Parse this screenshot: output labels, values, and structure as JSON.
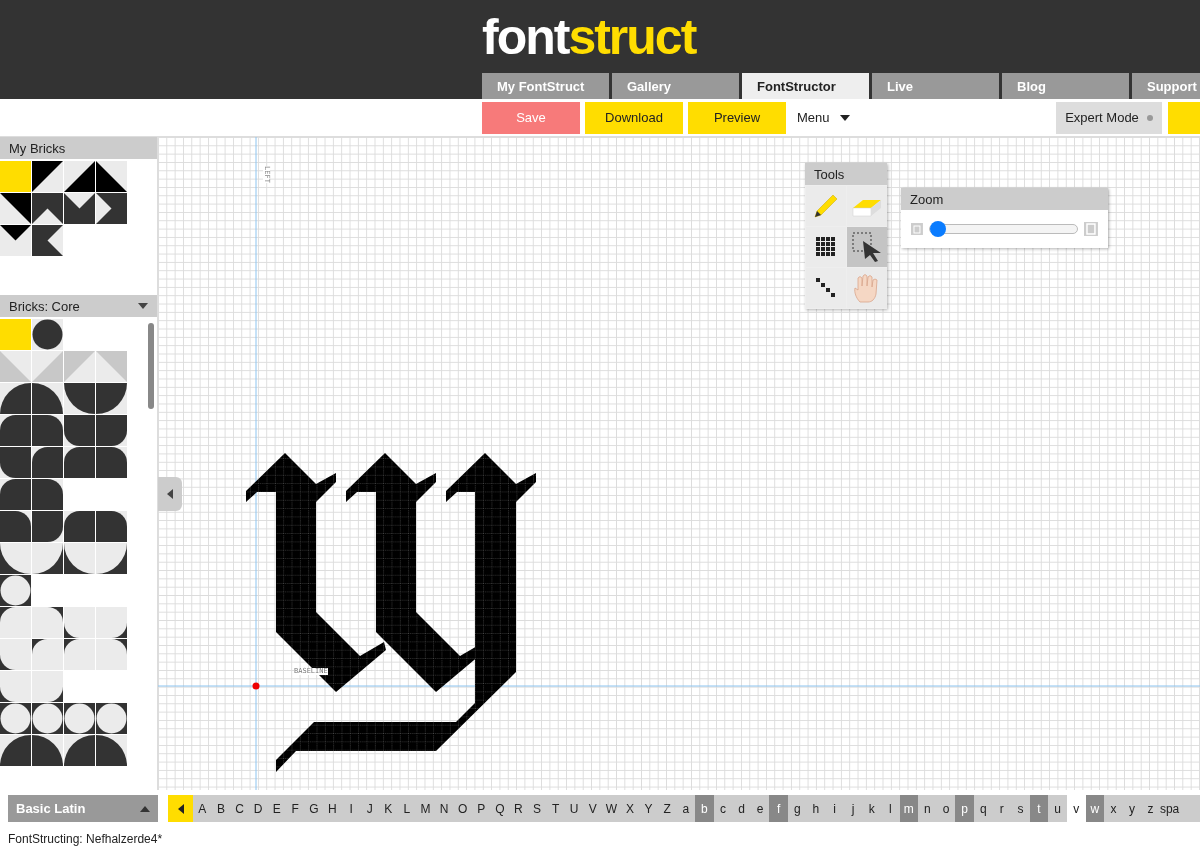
{
  "logo": {
    "part1": "font",
    "part2": "struct"
  },
  "tabs": [
    {
      "label": "My FontStruct",
      "selected": false
    },
    {
      "label": "Gallery",
      "selected": false
    },
    {
      "label": "FontStructor",
      "selected": true
    },
    {
      "label": "Live",
      "selected": false
    },
    {
      "label": "Blog",
      "selected": false
    },
    {
      "label": "Support",
      "selected": false
    }
  ],
  "toolbar": {
    "buttons": [
      {
        "label": "Save",
        "kind": "save"
      },
      {
        "label": "Download",
        "kind": "action"
      },
      {
        "label": "Preview",
        "kind": "action"
      }
    ],
    "menu": "Menu",
    "expert_mode": {
      "label": "Expert Mode",
      "on": false
    }
  },
  "my_bricks": {
    "title": "My Bricks",
    "rows": [
      [
        {
          "kind": "solid_tl_black",
          "selected": true
        },
        {
          "kind": "tri_tl_black",
          "selected": false
        },
        {
          "kind": "tri_br_black",
          "selected": false
        },
        {
          "kind": "tri_bl_black",
          "selected": false
        }
      ],
      [
        {
          "kind": "tri_tr_black",
          "selected": false
        },
        {
          "kind": "tri_b_inverse",
          "selected": false
        },
        {
          "kind": "tri_t_inverse",
          "selected": false
        },
        {
          "kind": "tri_l_inverse",
          "selected": false
        }
      ],
      [
        {
          "kind": "tri_t_black",
          "selected": false
        },
        {
          "kind": "tri_r_inverse",
          "selected": false
        }
      ]
    ]
  },
  "core_bricks": {
    "title": "Bricks: Core",
    "rows": [
      [
        {
          "kind": "solid_tl_dark",
          "selected": true
        },
        {
          "kind": "circle_tl_dark",
          "selected": false
        }
      ],
      [
        {
          "kind": "tri_bl_grey",
          "selected": false
        },
        {
          "kind": "tri_br_grey",
          "selected": false
        },
        {
          "kind": "tri_tl_grey",
          "selected": false
        },
        {
          "kind": "tri_tr_grey",
          "selected": false
        }
      ],
      [
        {
          "kind": "quarter_br_dark",
          "selected": false
        },
        {
          "kind": "quarter_bl_dark",
          "selected": false
        },
        {
          "kind": "quarter_tr_dark",
          "selected": false
        },
        {
          "kind": "quarter_tl_dark",
          "selected": false
        }
      ],
      [
        {
          "kind": "round_tl_dark",
          "selected": false
        },
        {
          "kind": "round_tr_dark",
          "selected": false
        },
        {
          "kind": "round_bl_dark",
          "selected": false
        },
        {
          "kind": "round_br_dark",
          "selected": false
        }
      ],
      [
        {
          "kind": "round_bl_dark",
          "selected": false
        },
        {
          "kind": "round_tl_dark",
          "selected": false
        },
        {
          "kind": "round_tl_dark",
          "selected": false
        },
        {
          "kind": "round_tr_dark",
          "selected": false
        }
      ],
      [
        {
          "kind": "round_tl_dark",
          "selected": false
        },
        {
          "kind": "round_tr_dark",
          "selected": false
        }
      ],
      [
        {
          "kind": "round_tr_dark",
          "selected": false
        },
        {
          "kind": "round_br_dark",
          "selected": false
        },
        {
          "kind": "round_tl_dark",
          "selected": false
        },
        {
          "kind": "round_tr_dark",
          "selected": false
        }
      ],
      [
        {
          "kind": "concave_bl_dark",
          "selected": false
        },
        {
          "kind": "concave_br_dark",
          "selected": false
        },
        {
          "kind": "concave_bl_dark",
          "selected": false
        },
        {
          "kind": "concave_br_dark",
          "selected": false
        }
      ],
      [
        {
          "kind": "circle_tl_inverse",
          "selected": false
        }
      ],
      [
        {
          "kind": "round_tl_inverse",
          "selected": false
        },
        {
          "kind": "round_tr_inverse",
          "selected": false
        },
        {
          "kind": "round_bl_inverse",
          "selected": false
        },
        {
          "kind": "round_br_inverse",
          "selected": false
        }
      ],
      [
        {
          "kind": "round_bl_inverse",
          "selected": false
        },
        {
          "kind": "round_tl_inverse",
          "selected": false
        },
        {
          "kind": "round_tl_inverse",
          "selected": false
        },
        {
          "kind": "round_tr_inverse",
          "selected": false
        }
      ],
      [
        {
          "kind": "round_bl_inverse",
          "selected": false
        },
        {
          "kind": "round_br_inverse",
          "selected": false
        }
      ],
      [
        {
          "kind": "circle_tl_inverse",
          "selected": false
        },
        {
          "kind": "circle_tl_inverse",
          "selected": false
        },
        {
          "kind": "circle_tl_inverse",
          "selected": false
        },
        {
          "kind": "circle_tl_inverse",
          "selected": false
        }
      ],
      [
        {
          "kind": "concave_tl_inverse",
          "selected": false
        },
        {
          "kind": "concave_tr_inverse",
          "selected": false
        },
        {
          "kind": "concave_tl_inverse",
          "selected": false
        },
        {
          "kind": "concave_tr_inverse",
          "selected": false
        }
      ]
    ]
  },
  "canvas": {
    "left_label": "LEFT",
    "baseline_label": "BASELINE"
  },
  "tools": {
    "title": "Tools",
    "items": [
      {
        "kind": "pencil",
        "selected": false
      },
      {
        "kind": "eraser",
        "selected": false
      },
      {
        "kind": "fill",
        "selected": false
      },
      {
        "kind": "select",
        "selected": true
      },
      {
        "kind": "line",
        "selected": false
      },
      {
        "kind": "hand",
        "selected": false
      }
    ]
  },
  "zoom": {
    "title": "Zoom",
    "level": 0
  },
  "charset": {
    "label": "Basic Latin"
  },
  "letters": [
    {
      "char": "A",
      "filled": false,
      "selected": false
    },
    {
      "char": "B",
      "filled": false,
      "selected": false
    },
    {
      "char": "C",
      "filled": false,
      "selected": false
    },
    {
      "char": "D",
      "filled": false,
      "selected": false
    },
    {
      "char": "E",
      "filled": false,
      "selected": false
    },
    {
      "char": "F",
      "filled": false,
      "selected": false
    },
    {
      "char": "G",
      "filled": false,
      "selected": false
    },
    {
      "char": "H",
      "filled": false,
      "selected": false
    },
    {
      "char": "I",
      "filled": false,
      "selected": false
    },
    {
      "char": "J",
      "filled": false,
      "selected": false
    },
    {
      "char": "K",
      "filled": false,
      "selected": false
    },
    {
      "char": "L",
      "filled": false,
      "selected": false
    },
    {
      "char": "M",
      "filled": false,
      "selected": false
    },
    {
      "char": "N",
      "filled": false,
      "selected": false
    },
    {
      "char": "O",
      "filled": false,
      "selected": false
    },
    {
      "char": "P",
      "filled": false,
      "selected": false
    },
    {
      "char": "Q",
      "filled": false,
      "selected": false
    },
    {
      "char": "R",
      "filled": false,
      "selected": false
    },
    {
      "char": "S",
      "filled": false,
      "selected": false
    },
    {
      "char": "T",
      "filled": false,
      "selected": false
    },
    {
      "char": "U",
      "filled": false,
      "selected": false
    },
    {
      "char": "V",
      "filled": false,
      "selected": false
    },
    {
      "char": "W",
      "filled": false,
      "selected": false
    },
    {
      "char": "X",
      "filled": false,
      "selected": false
    },
    {
      "char": "Y",
      "filled": false,
      "selected": false
    },
    {
      "char": "Z",
      "filled": false,
      "selected": false
    },
    {
      "char": "a",
      "filled": false,
      "selected": false
    },
    {
      "char": "b",
      "filled": true,
      "selected": false
    },
    {
      "char": "c",
      "filled": false,
      "selected": false
    },
    {
      "char": "d",
      "filled": false,
      "selected": false
    },
    {
      "char": "e",
      "filled": false,
      "selected": false
    },
    {
      "char": "f",
      "filled": true,
      "selected": false
    },
    {
      "char": "g",
      "filled": false,
      "selected": false
    },
    {
      "char": "h",
      "filled": false,
      "selected": false
    },
    {
      "char": "i",
      "filled": false,
      "selected": false
    },
    {
      "char": "j",
      "filled": false,
      "selected": false
    },
    {
      "char": "k",
      "filled": false,
      "selected": false
    },
    {
      "char": "l",
      "filled": false,
      "selected": false
    },
    {
      "char": "m",
      "filled": true,
      "selected": false
    },
    {
      "char": "n",
      "filled": false,
      "selected": false
    },
    {
      "char": "o",
      "filled": false,
      "selected": false
    },
    {
      "char": "p",
      "filled": true,
      "selected": false
    },
    {
      "char": "q",
      "filled": false,
      "selected": false
    },
    {
      "char": "r",
      "filled": false,
      "selected": false
    },
    {
      "char": "s",
      "filled": false,
      "selected": false
    },
    {
      "char": "t",
      "filled": true,
      "selected": false
    },
    {
      "char": "u",
      "filled": false,
      "selected": false
    },
    {
      "char": "v",
      "filled": false,
      "selected": true
    },
    {
      "char": "w",
      "filled": true,
      "selected": false
    },
    {
      "char": "x",
      "filled": false,
      "selected": false
    },
    {
      "char": "y",
      "filled": false,
      "selected": false
    },
    {
      "char": "z",
      "filled": false,
      "selected": false
    },
    {
      "char": "spa",
      "filled": false,
      "selected": false
    }
  ],
  "status_bar": "FontStructing: Nefhalzerde4*"
}
